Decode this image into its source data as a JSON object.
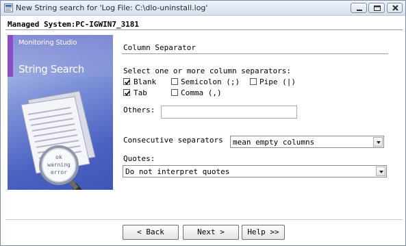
{
  "window": {
    "title": "New String search for 'Log File: C:\\dlo-uninstall.log'"
  },
  "header": {
    "managed_system": "Managed System:PC-IGWIN7_3181"
  },
  "banner": {
    "subtitle": "Monitoring Studio",
    "title": "String Search",
    "magnifier_text": [
      "ok",
      "warning",
      "error"
    ],
    "colors": {
      "stripe": "#8d4bc5",
      "background": "#4a61c1"
    }
  },
  "section": {
    "title": "Column Separator",
    "instruction": "Select one or more column separators:"
  },
  "separators": [
    {
      "label": "Blank",
      "checked": true
    },
    {
      "label": "Semicolon (;)",
      "checked": false
    },
    {
      "label": "Pipe (|)",
      "checked": false
    },
    {
      "label": "Tab",
      "checked": true
    },
    {
      "label": "Comma (,)",
      "checked": false
    }
  ],
  "others": {
    "label": "Others:",
    "value": ""
  },
  "consecutive": {
    "label": "Consecutive separators",
    "selected": "mean empty columns"
  },
  "quotes": {
    "label": "Quotes:",
    "selected": "Do not interpret quotes"
  },
  "buttons": {
    "back": "< Back",
    "next": "Next >",
    "help": "Help >>"
  }
}
